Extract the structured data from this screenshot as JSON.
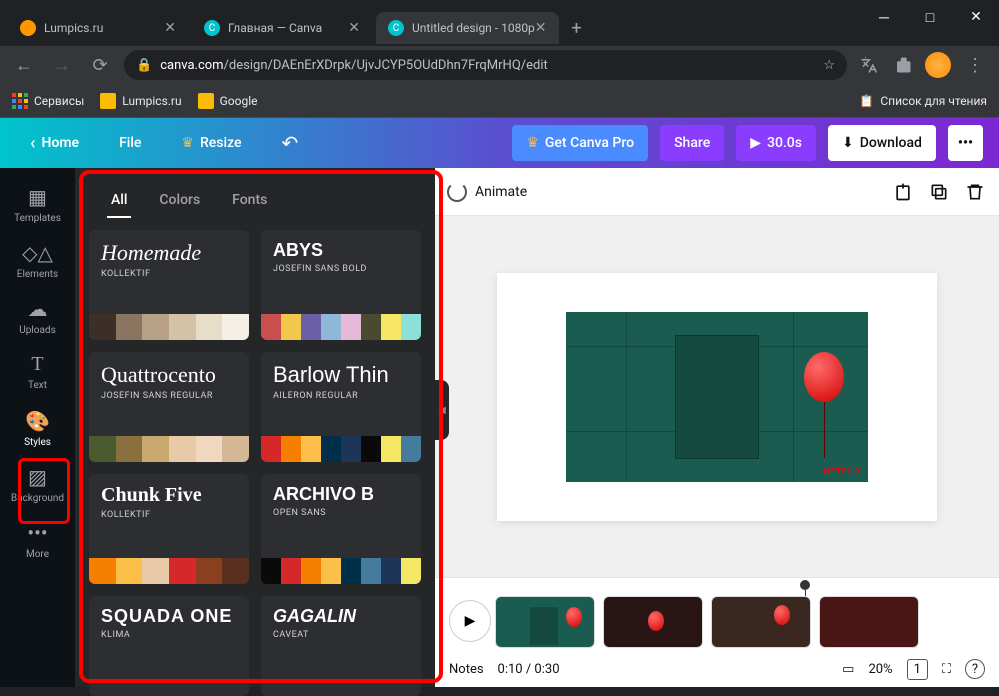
{
  "browser": {
    "tabs": [
      {
        "title": "Lumpics.ru",
        "favicon_color": "#ff9800"
      },
      {
        "title": "Главная — Canva",
        "favicon_color": "#00c4cc"
      },
      {
        "title": "Untitled design - 1080p",
        "favicon_color": "#00c4cc"
      }
    ],
    "url_host": "canva.com",
    "url_path": "/design/DAEnErXDrpk/UjvJCYP5OUdDhn7FrqMrHQ/edit",
    "bookmarks": {
      "services": "Сервисы",
      "lumpics": "Lumpics.ru",
      "google": "Google",
      "reading_list": "Список для чтения"
    }
  },
  "canva_header": {
    "home": "Home",
    "file": "File",
    "resize": "Resize",
    "get_pro": "Get Canva Pro",
    "share": "Share",
    "duration": "30.0s",
    "download": "Download"
  },
  "rail": {
    "templates": "Templates",
    "elements": "Elements",
    "uploads": "Uploads",
    "text": "Text",
    "styles": "Styles",
    "background": "Background",
    "more": "More"
  },
  "panel": {
    "tabs": {
      "all": "All",
      "colors": "Colors",
      "fonts": "Fonts"
    },
    "styles": [
      {
        "title": "Homemade",
        "title_font": "cursive",
        "sub": "Kollektif",
        "palette": [
          "#3b2f28",
          "#8a7560",
          "#b89f87",
          "#d4c2a8",
          "#e8ddc9",
          "#f5f0e6"
        ]
      },
      {
        "title": "ABYS",
        "title_font": "bold",
        "sub": "Josefin Sans Bold",
        "palette": [
          "#c94f4f",
          "#f2c84b",
          "#6b5fa8",
          "#8fb8d8",
          "#e8b8d8",
          "#4a4a2f",
          "#f5e663",
          "#8de0d8"
        ]
      },
      {
        "title": "Quattrocento",
        "title_font": "serif",
        "sub": "JOSEFIN SANS REGULAR",
        "palette": [
          "#4a5a2f",
          "#8a6f3f",
          "#c9a86f",
          "#e8c9a8",
          "#f0d8c0",
          "#d4b896"
        ]
      },
      {
        "title": "Barlow Thin",
        "title_font": "thin",
        "sub": "AILERON REGULAR",
        "palette": [
          "#d62828",
          "#f77f00",
          "#fcbf49",
          "#003049",
          "#1d3557",
          "#0a0a0a",
          "#f5e663",
          "#457b9d"
        ]
      },
      {
        "title": "Chunk Five",
        "title_font": "slab",
        "sub": "Kollektif",
        "palette": [
          "#f77f00",
          "#fcbf49",
          "#e8c9a8",
          "#d62828",
          "#8a3f1f",
          "#5a2f1f"
        ]
      },
      {
        "title": "ARCHIVO B",
        "title_font": "archivo",
        "sub": "OPEN SANS",
        "palette": [
          "#0a0a0a",
          "#d62828",
          "#f77f00",
          "#fcbf49",
          "#003049",
          "#457b9d",
          "#1d3557",
          "#f5e663"
        ]
      },
      {
        "title": "SQUADA ONE",
        "title_font": "squada",
        "sub": "Klima",
        "palette": []
      },
      {
        "title": "GAGALIN",
        "title_font": "gagalin",
        "sub": "Caveat",
        "palette": []
      }
    ]
  },
  "toolbar": {
    "animate": "Animate"
  },
  "video": {
    "netflix": "NETFLIX"
  },
  "timeline": {
    "notes": "Notes",
    "time": "0:10 / 0:30",
    "zoom": "20%",
    "page": "1"
  }
}
